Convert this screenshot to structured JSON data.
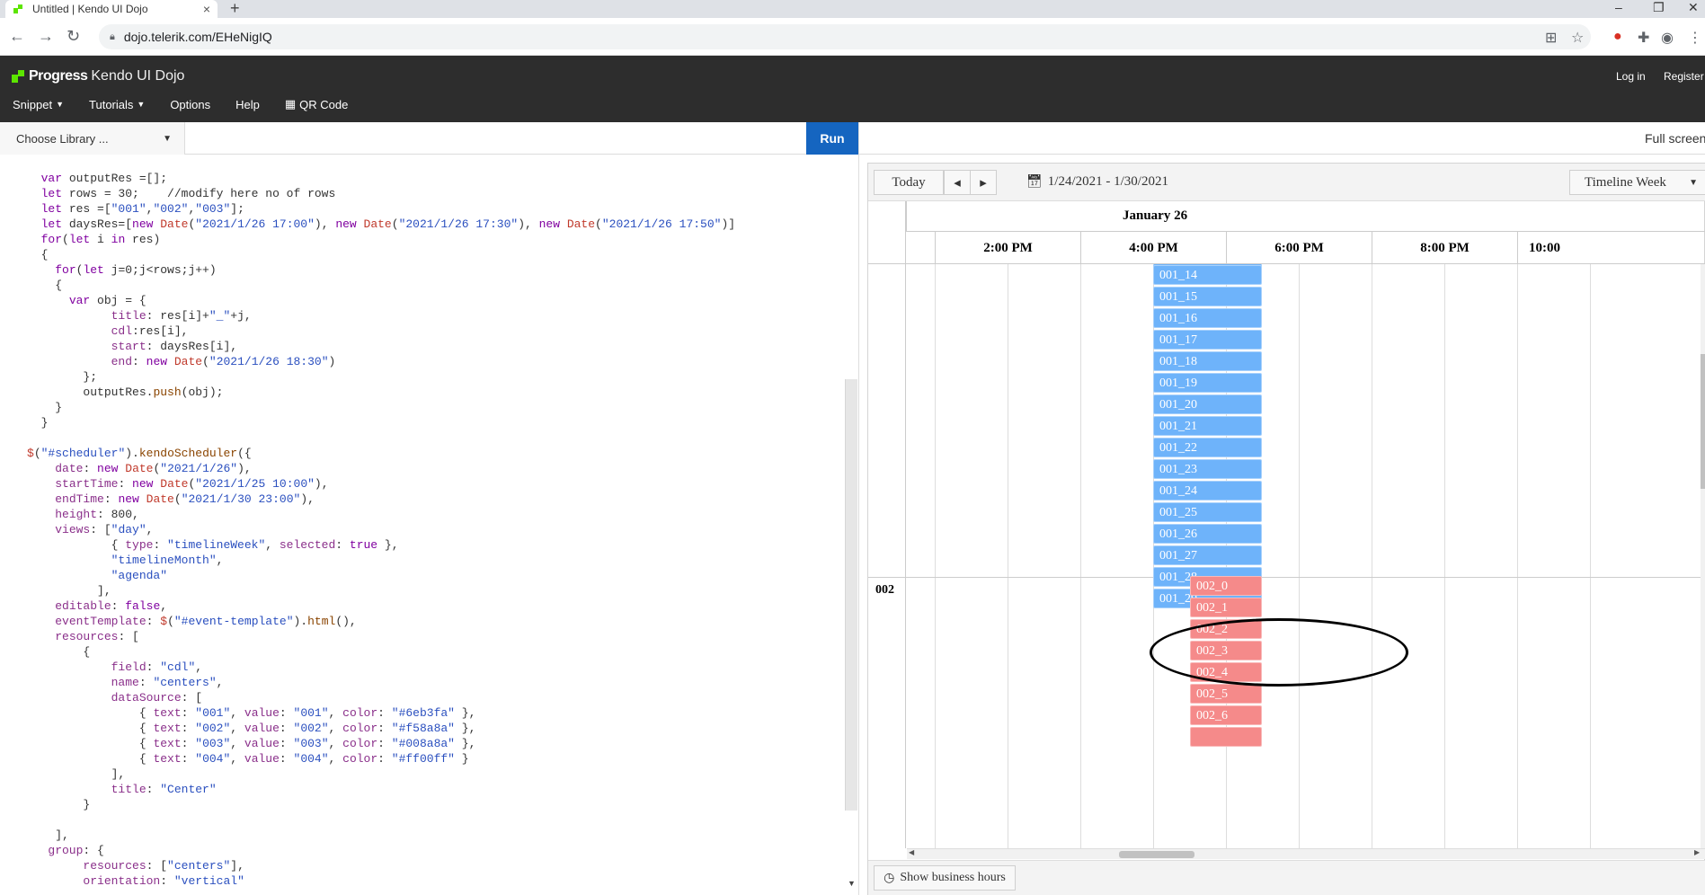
{
  "browser": {
    "tab_title": "Untitled | Kendo UI Dojo",
    "new_tab": "+",
    "url": "dojo.telerik.com/EHeNigIQ",
    "minimize": "–",
    "restore": "❐",
    "close": "✕"
  },
  "dojo": {
    "brand_main": "Progress",
    "brand_sub": "Kendo UI Dojo",
    "menu": [
      {
        "label": "Snippet",
        "caret": "▼"
      },
      {
        "label": "Tutorials",
        "caret": "▼"
      },
      {
        "label": "Options"
      },
      {
        "label": "Help"
      },
      {
        "label": "QR Code"
      }
    ],
    "login": "Log in",
    "register": "Register"
  },
  "toolbar": {
    "library": "Choose Library ...",
    "run": "Run",
    "fullscreen": "Full screen"
  },
  "scheduler": {
    "today": "Today",
    "prev": "◂",
    "next": "▸",
    "date_range": "1/24/2021 - 1/30/2021",
    "view": "Timeline Week",
    "date_header": "January 26",
    "time_headers": [
      "2:00 PM",
      "4:00 PM",
      "6:00 PM",
      "8:00 PM",
      "10:00"
    ],
    "group_label": "002",
    "events_001": [
      "001_14",
      "001_15",
      "001_16",
      "001_17",
      "001_18",
      "001_19",
      "001_20",
      "001_21",
      "001_22",
      "001_23",
      "001_24",
      "001_25",
      "001_26",
      "001_27",
      "001_28",
      "001_29"
    ],
    "events_002": [
      "002_0",
      "002_1",
      "002_2",
      "002_3",
      "002_4",
      "002_5",
      "002_6"
    ],
    "footer_btn": "Show business hours",
    "colors": {
      "c001": "#6eb3fa",
      "c002": "#f58a8a"
    }
  }
}
